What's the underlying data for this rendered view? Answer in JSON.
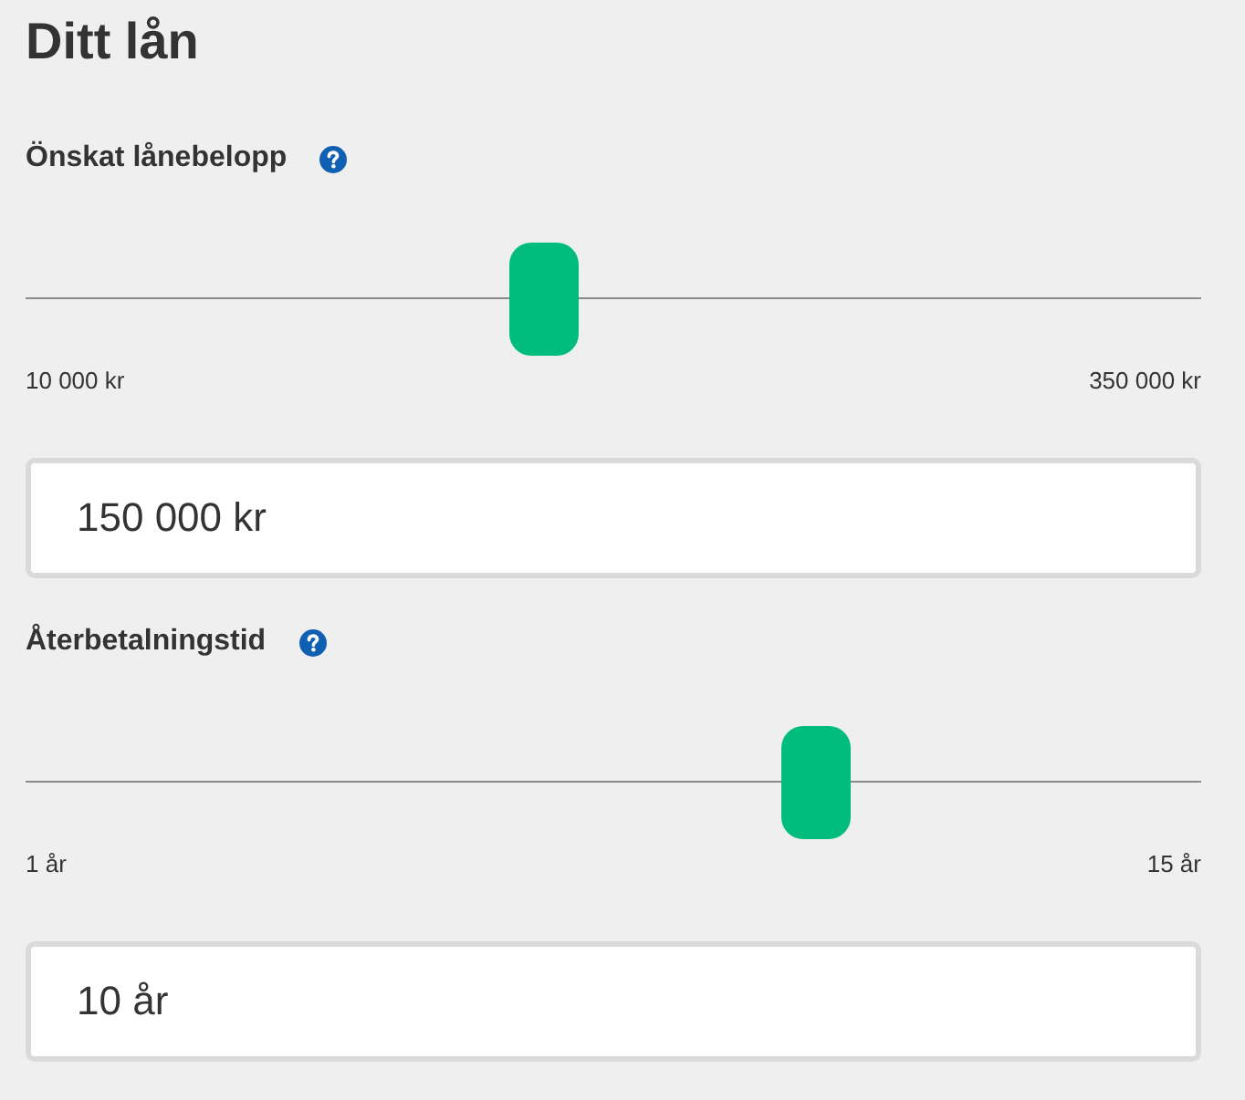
{
  "title": "Ditt lån",
  "sliders": [
    {
      "label": "Önskat lånebelopp",
      "level": 0.437,
      "min_label": "10 000 kr",
      "max_label": "350 000 kr",
      "value": "150 000 kr"
    },
    {
      "label": "Återbetalningstid",
      "level": 0.683,
      "min_label": "1 år",
      "max_label": "15 år",
      "value": "10 år"
    }
  ]
}
